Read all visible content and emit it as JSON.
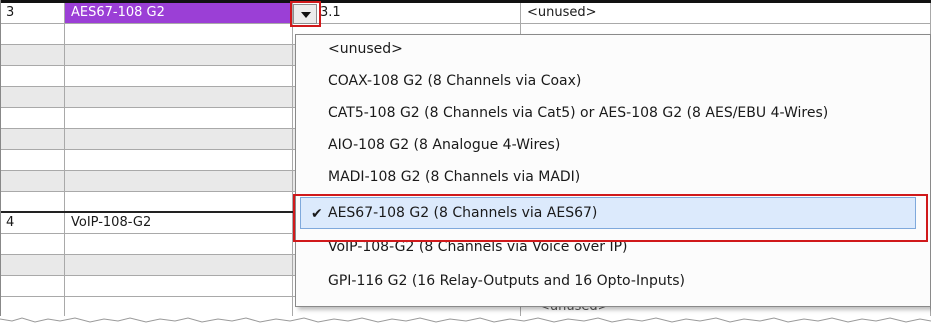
{
  "table": {
    "rows": [
      {
        "num": "3",
        "module": "AES67-108 G2",
        "channel": "3.1",
        "function": "<unused>"
      },
      {
        "num": "",
        "module": "",
        "channel": "",
        "function": ""
      },
      {
        "num": "4",
        "module": "VoIP-108-G2",
        "channel": "",
        "function": ""
      }
    ],
    "partial_function": "<unused>"
  },
  "dropdown": {
    "items": [
      "<unused>",
      "COAX-108 G2 (8 Channels via Coax)",
      "CAT5-108 G2 (8 Channels via Cat5) or AES-108 G2 (8 AES/EBU 4-Wires)",
      "AIO-108 G2 (8 Analogue 4-Wires)",
      "MADI-108 G2 (8 Channels via MADI)",
      "AES67-108 G2 (8 Channels via AES67)",
      "VoIP-108-G2 (8 Channels via Voice over IP)",
      "GPI-116 G2 (16 Relay-Outputs and 16 Opto-Inputs)"
    ],
    "selected_index": 5,
    "check_glyph": "✔"
  },
  "colors": {
    "selected_cell": "#9b3fd6",
    "highlight": "#dceafc",
    "callout_red": "#d0191b"
  }
}
